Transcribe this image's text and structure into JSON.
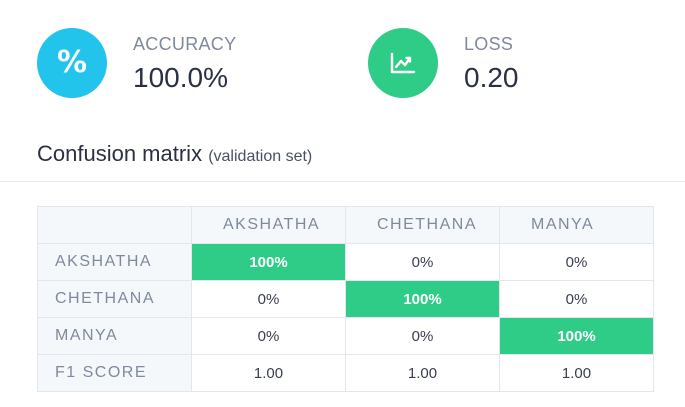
{
  "metrics": {
    "accuracy": {
      "label": "ACCURACY",
      "value": "100.0%",
      "icon": "percent-icon",
      "color": "#23c4ec"
    },
    "loss": {
      "label": "LOSS",
      "value": "0.20",
      "icon": "line-chart-icon",
      "color": "#2ecc87"
    }
  },
  "confusion": {
    "title": "Confusion matrix",
    "subtitle": "(validation set)",
    "columns": [
      "AKSHATHA",
      "CHETHANA",
      "MANYA"
    ],
    "rows": [
      {
        "label": "AKSHATHA",
        "cells": [
          "100%",
          "0%",
          "0%"
        ]
      },
      {
        "label": "CHETHANA",
        "cells": [
          "0%",
          "100%",
          "0%"
        ]
      },
      {
        "label": "MANYA",
        "cells": [
          "0%",
          "0%",
          "100%"
        ]
      }
    ],
    "f1": {
      "label": "F1 SCORE",
      "cells": [
        "1.00",
        "1.00",
        "1.00"
      ]
    },
    "highlight_color": "#2ecc87"
  }
}
